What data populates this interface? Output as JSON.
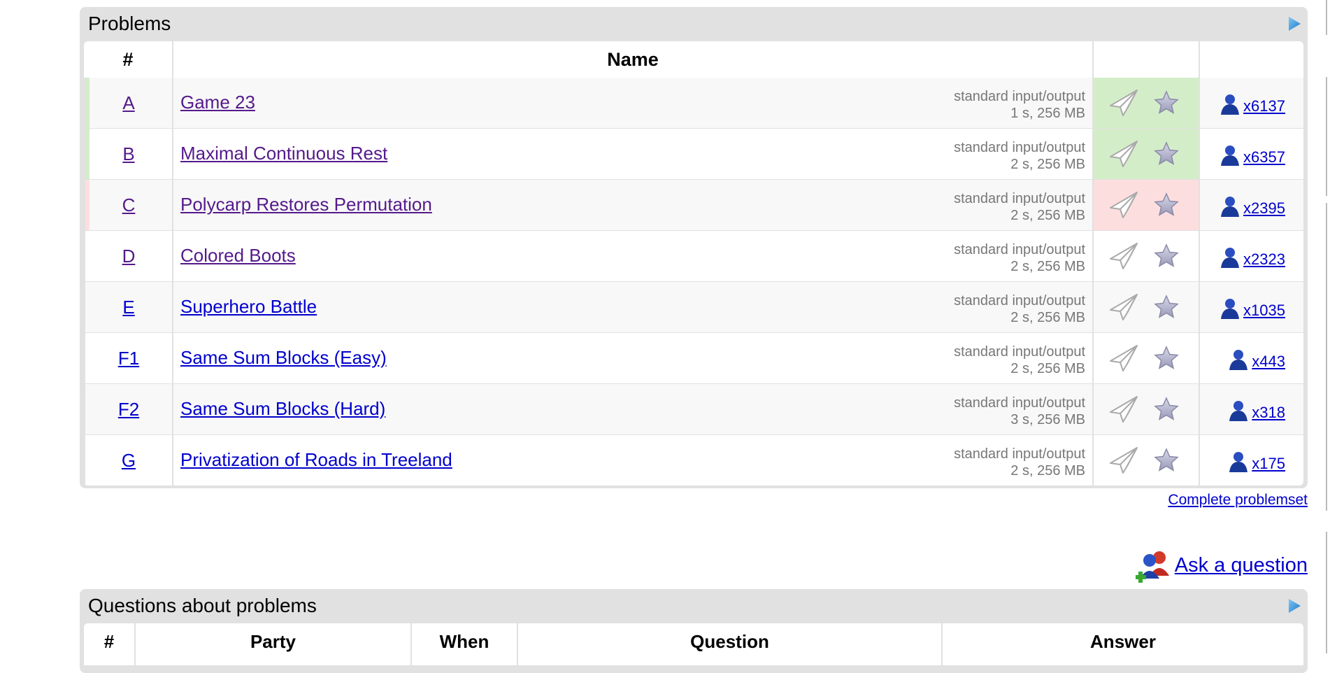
{
  "problems_panel": {
    "title": "Problems",
    "columns": [
      "#",
      "Name",
      "",
      ""
    ],
    "rows": [
      {
        "index": "A",
        "name": "Game 23",
        "io": "standard input/output",
        "limits": "1 s, 256 MB",
        "solved": "x6137",
        "status": "accepted",
        "visited": true
      },
      {
        "index": "B",
        "name": "Maximal Continuous Rest",
        "io": "standard input/output",
        "limits": "2 s, 256 MB",
        "solved": "x6357",
        "status": "accepted",
        "visited": true
      },
      {
        "index": "C",
        "name": "Polycarp Restores Permutation",
        "io": "standard input/output",
        "limits": "2 s, 256 MB",
        "solved": "x2395",
        "status": "rejected",
        "visited": true
      },
      {
        "index": "D",
        "name": "Colored Boots",
        "io": "standard input/output",
        "limits": "2 s, 256 MB",
        "solved": "x2323",
        "status": "none",
        "visited": true
      },
      {
        "index": "E",
        "name": "Superhero Battle",
        "io": "standard input/output",
        "limits": "2 s, 256 MB",
        "solved": "x1035",
        "status": "none",
        "visited": false
      },
      {
        "index": "F1",
        "name": "Same Sum Blocks (Easy)",
        "io": "standard input/output",
        "limits": "2 s, 256 MB",
        "solved": "x443",
        "status": "none",
        "visited": false
      },
      {
        "index": "F2",
        "name": "Same Sum Blocks (Hard)",
        "io": "standard input/output",
        "limits": "3 s, 256 MB",
        "solved": "x318",
        "status": "none",
        "visited": false
      },
      {
        "index": "G",
        "name": "Privatization of Roads in Treeland",
        "io": "standard input/output",
        "limits": "2 s, 256 MB",
        "solved": "x175",
        "status": "none",
        "visited": false
      }
    ],
    "complete_link": "Complete problemset"
  },
  "ask_question": {
    "label": "Ask a question",
    "icon": "ask-question-users-icon"
  },
  "questions_panel": {
    "title": "Questions about problems",
    "columns": [
      "#",
      "Party",
      "When",
      "Question",
      "Answer"
    ]
  },
  "colors": {
    "link": "#0000cc",
    "visited_link": "#551a8b",
    "accepted_bg": "#d4edc9",
    "rejected_bg": "#fddede",
    "panel_bg": "#e1e1e1",
    "limits_text": "#777777"
  },
  "icons": {
    "submit": "paper-plane-icon",
    "favourite": "star-icon",
    "solved_by": "user-icon",
    "panel_toggle": "triangle-right-icon"
  }
}
